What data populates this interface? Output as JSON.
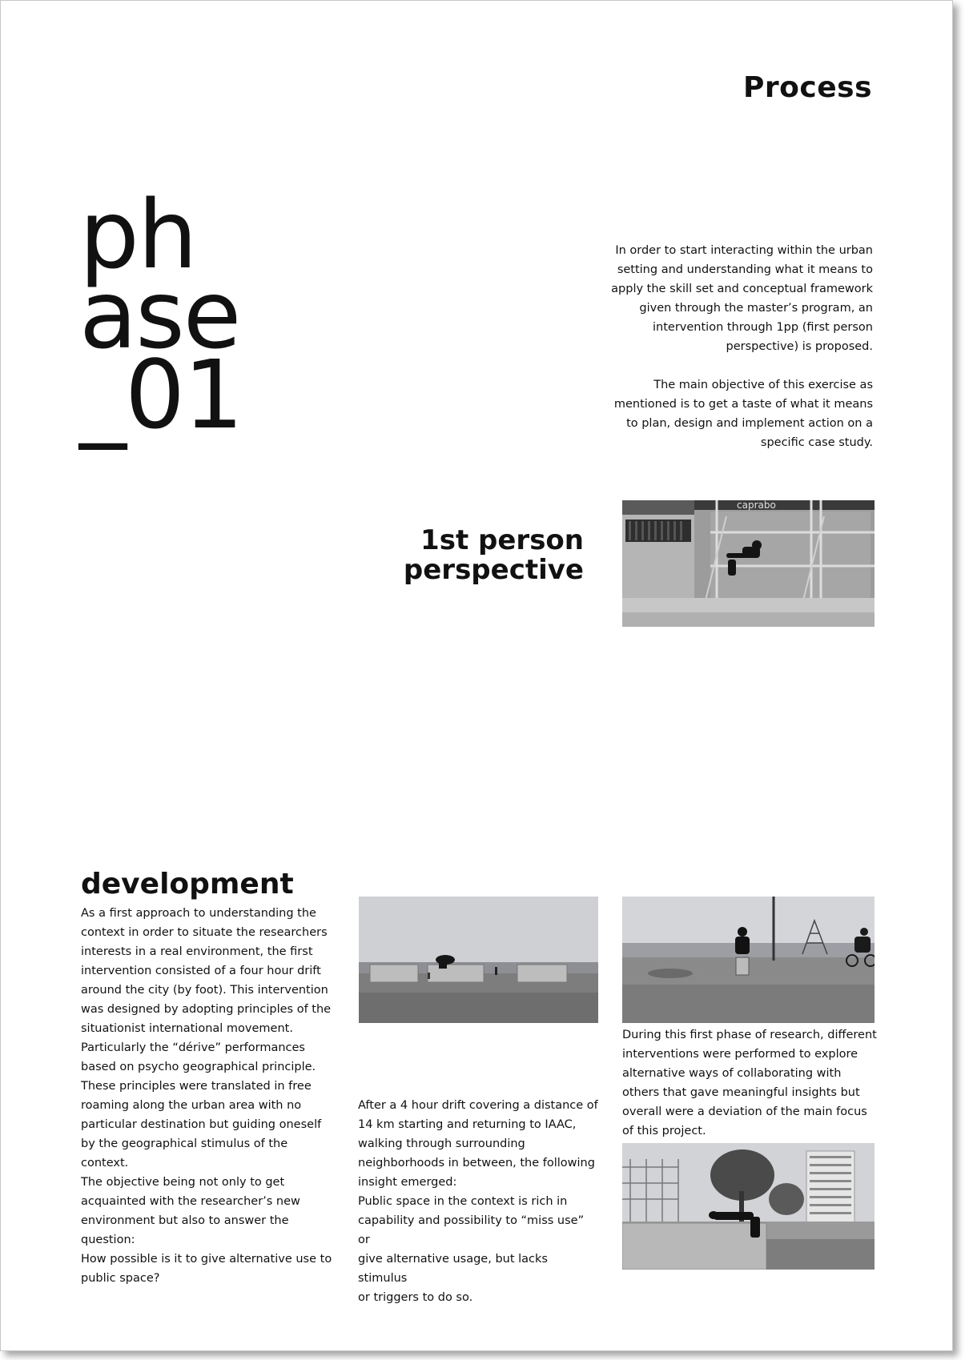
{
  "header": {
    "title": "Process"
  },
  "hero": {
    "lines": [
      "ph",
      "ase",
      "_01"
    ]
  },
  "intro": {
    "p1": "In order to start interacting within the urban setting and understanding what it means to apply the skill set and conceptual framework given through the master’s program, an intervention through 1pp (first person perspective) is proposed.",
    "p2": "The main objective of this exercise as mentioned is to get a taste of what it means to plan, design and implement action on a specific case study."
  },
  "section1": {
    "heading_line1": "1st person",
    "heading_line2": "perspective",
    "photo_sign_text": "caprabo"
  },
  "development": {
    "heading": "development",
    "col1_lines": [
      "As a first approach to understanding the",
      "context in order to situate the researchers",
      "interests in a real environment, the first",
      "intervention consisted of a four hour drift",
      "around the city (by foot). This intervention",
      "was designed by adopting principles of the",
      "situationist international movement.",
      "Particularly the “dérive” performances",
      "based on psycho geographical principle.",
      "These principles were translated in free",
      "roaming along the urban area with no",
      "particular destination but guiding oneself",
      "by the geographical stimulus of the context.",
      "The objective being not only to get",
      "acquainted with the researcher’s new",
      "environment but also to answer the",
      "question:",
      "How possible is it to give alternative use to",
      "public space?"
    ],
    "col2_lines": [
      "After a 4 hour drift covering a distance of",
      "14 km starting and returning to IAAC,",
      "walking through surrounding",
      "neighborhoods in between, the following",
      "insight emerged:",
      "Public space in the context is rich in",
      "capability and possibility to “miss use” or",
      "give alternative usage, but lacks stimulus",
      "or triggers to do so."
    ],
    "col3_lines": [
      "During this first phase of research, different",
      "interventions were performed to explore",
      "alternative ways of collaborating with",
      "others that gave meaningful insights but",
      "overall were a deviation of the main focus",
      "of this project."
    ]
  }
}
